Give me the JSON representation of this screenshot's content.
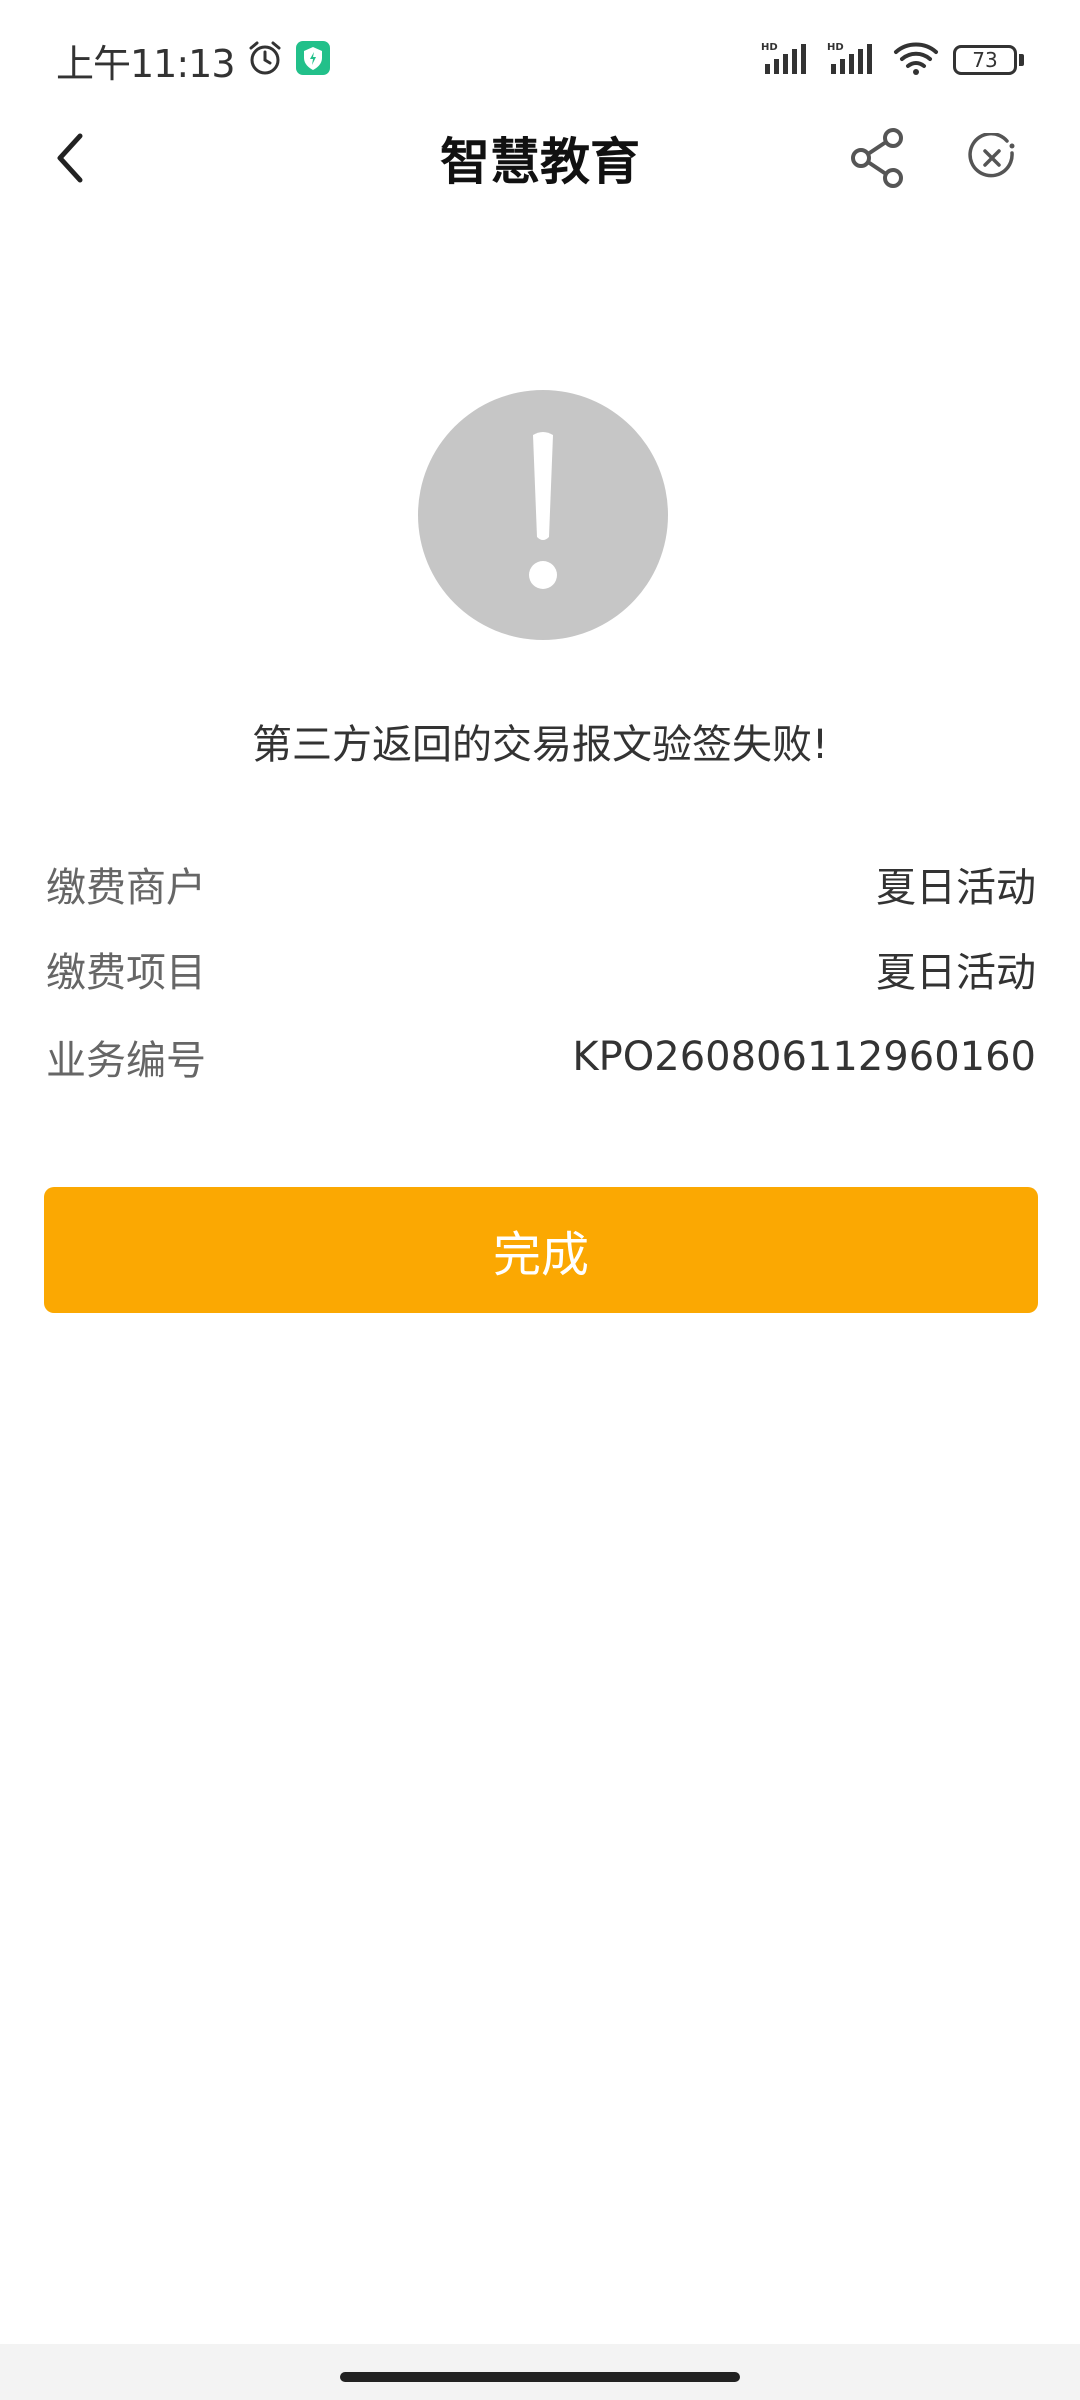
{
  "status_bar": {
    "time": "上午11:13",
    "battery": "73",
    "alarm_icon": "alarm-clock-icon",
    "app_badge_icon": "shield-app-icon",
    "signal_icon": "hd-signal-icon",
    "wifi_icon": "wifi-icon",
    "badge_color": "#22c08a"
  },
  "nav": {
    "title": "智慧教育",
    "back_icon": "chevron-left-icon",
    "share_icon": "share-icon",
    "close_icon": "close-circle-icon"
  },
  "alert": {
    "icon": "exclamation-icon",
    "message": "第三方返回的交易报文验签失败!"
  },
  "details": [
    {
      "label": "缴费商户",
      "value": "夏日活动"
    },
    {
      "label": "缴费项目",
      "value": "夏日活动"
    },
    {
      "label": "业务编号",
      "value": "KPO260806112960160"
    }
  ],
  "actions": {
    "done_label": "完成"
  },
  "colors": {
    "accent": "#fba802",
    "alert_circle": "#c6c6c6"
  }
}
